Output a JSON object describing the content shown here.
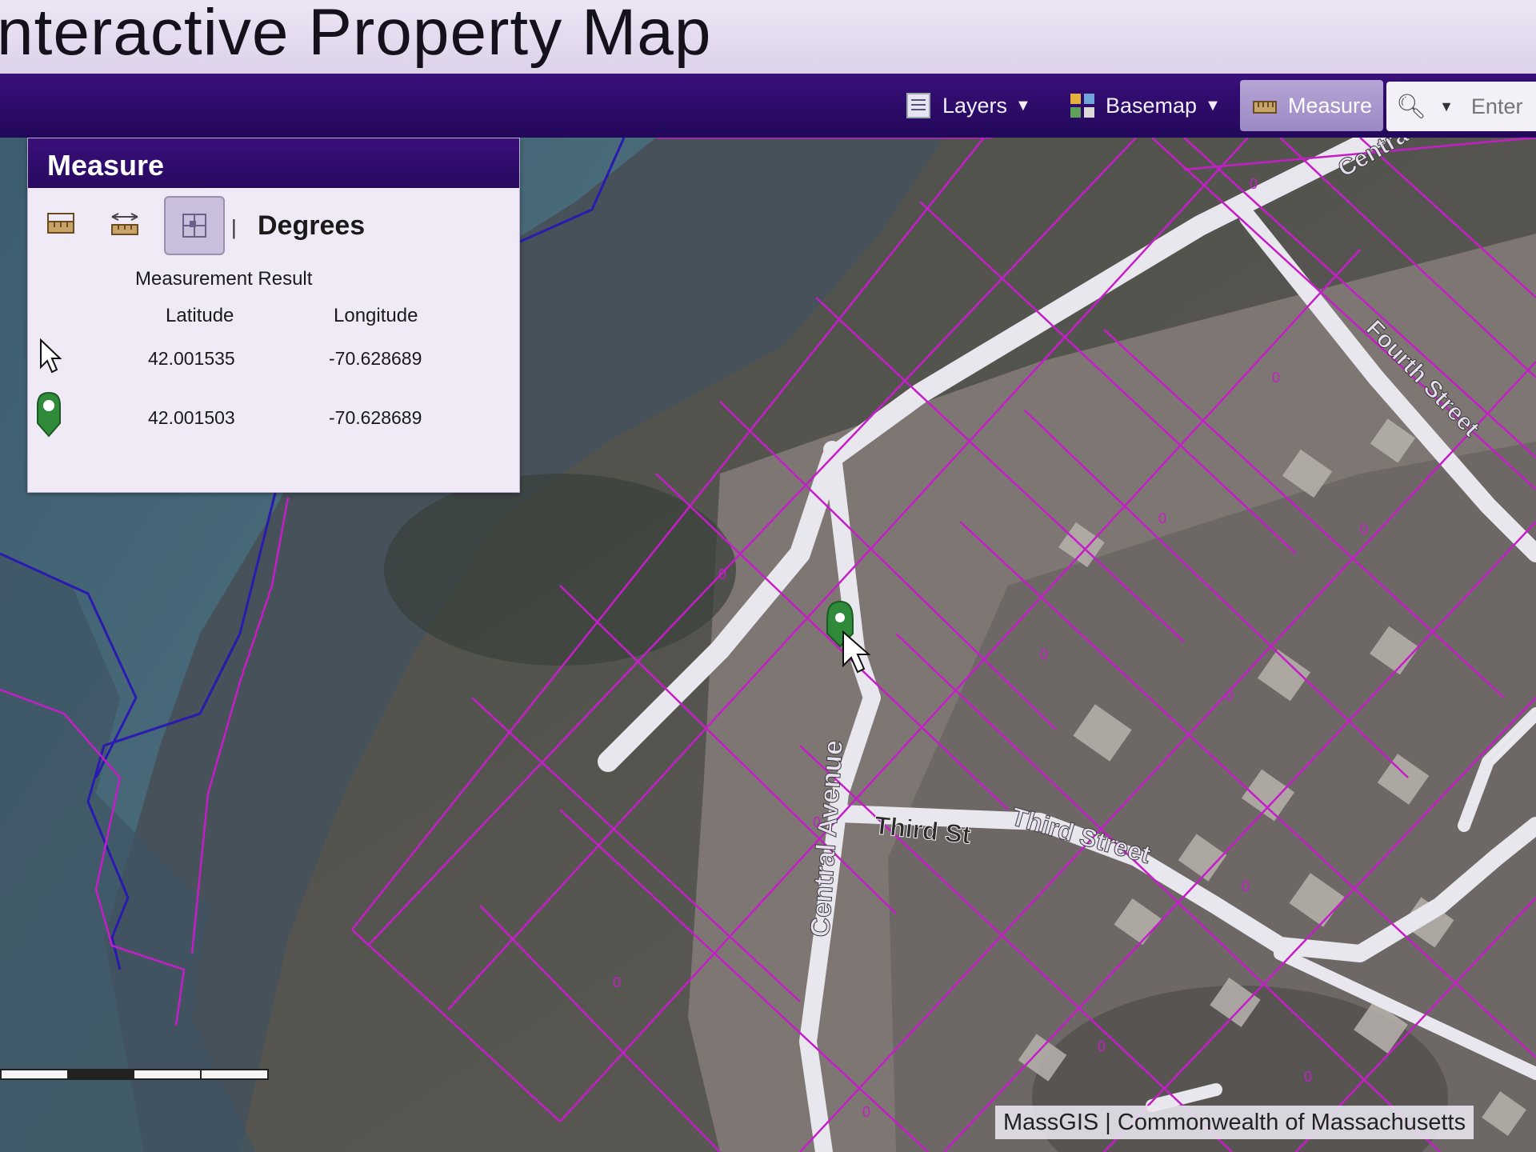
{
  "page": {
    "title": "nteractive Property Map"
  },
  "toolbar": {
    "layers_label": "Layers",
    "basemap_label": "Basemap",
    "measure_label": "Measure",
    "search_placeholder": "Enter a",
    "icons": [
      "layers-icon",
      "basemap-icon",
      "measure-icon",
      "search-icon"
    ]
  },
  "measure_panel": {
    "title": "Measure",
    "unit": "Degrees",
    "result_title": "Measurement Result",
    "columns": [
      "Latitude",
      "Longitude"
    ],
    "rows": [
      {
        "icon": "cursor-icon",
        "latitude": "42.001535",
        "longitude": "-70.628689"
      },
      {
        "icon": "map-pin-icon",
        "latitude": "42.001503",
        "longitude": "-70.628689"
      }
    ]
  },
  "map": {
    "street_labels": [
      "Central Avenue",
      "Third Street",
      "Fourth Street",
      "Central",
      "Third St"
    ],
    "parcel_label": "0",
    "attribution": "MassGIS | Commonwealth of Massachusetts",
    "colors": {
      "parcel": "#c51ec8",
      "boundary": "#2a1ab0",
      "road": "#e9e7ee",
      "toolbar": "#2a0a6a"
    }
  }
}
